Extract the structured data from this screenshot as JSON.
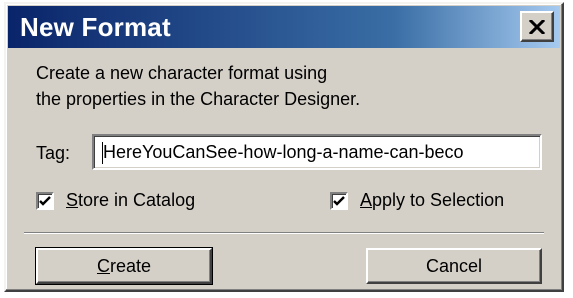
{
  "dialog": {
    "title": "New Format",
    "description_line1": "Create a new character format using",
    "description_line2": "the properties in the Character Designer.",
    "tag_label": "Tag:",
    "tag_value": "HereYouCanSee-how-long-a-name-can-beco",
    "store_in_catalog": {
      "mnemonic": "S",
      "label_rest": "tore in Catalog",
      "checked": true
    },
    "apply_to_selection": {
      "mnemonic": "A",
      "label_rest": "pply to Selection",
      "checked": true
    },
    "create_button": {
      "mnemonic": "C",
      "label_rest": "reate"
    },
    "cancel_button": "Cancel"
  },
  "icons": {
    "close": "close-icon",
    "check": "checkmark-icon"
  },
  "colors": {
    "titlebar_start": "#0a246a",
    "titlebar_end": "#a6caf0",
    "face": "#d4d0c8"
  }
}
